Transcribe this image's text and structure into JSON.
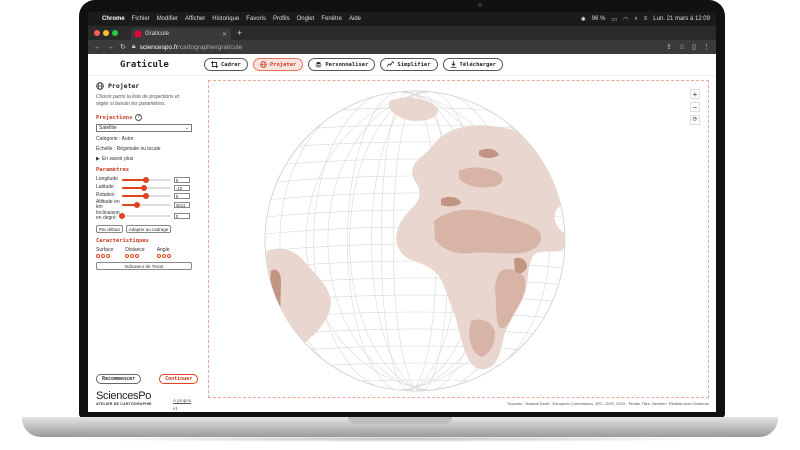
{
  "menubar": {
    "items": [
      "Chrome",
      "Fichier",
      "Modifier",
      "Afficher",
      "Historique",
      "Favoris",
      "Profils",
      "Onglet",
      "Fenêtre",
      "Aide"
    ],
    "battery": "96 %",
    "datetime": "Lun. 21 mars à 12:09"
  },
  "browser": {
    "tab_title": "Graticule",
    "url_host": "sciencespo.fr",
    "url_path": "/cartographie/graticule"
  },
  "app": {
    "logo": "Graticule",
    "steps": [
      {
        "label": "Cadrer",
        "icon": "crop-icon",
        "active": false
      },
      {
        "label": "Projeter",
        "icon": "globe-icon",
        "active": true
      },
      {
        "label": "Personnaliser",
        "icon": "layers-icon",
        "active": false
      },
      {
        "label": "Simplifier",
        "icon": "line-chart-icon",
        "active": false
      },
      {
        "label": "Télécharger",
        "icon": "download-icon",
        "active": false
      }
    ]
  },
  "sidebar": {
    "title": "Projeter",
    "description": "Choisir parmi la liste de projections et régler si besoin les paramètres.",
    "projections_heading": "Projections",
    "projection_selected": "Satellite",
    "category": "Catégorie : Autre",
    "scale": "Échelle : Régionale ou locale",
    "more": "En savoir plus",
    "params_heading": "Paramètres",
    "params": [
      {
        "label": "Longitude",
        "value": "0",
        "fraction": 0.5
      },
      {
        "label": "Latitude",
        "value": "-10",
        "fraction": 0.46
      },
      {
        "label": "Rotation",
        "value": "0",
        "fraction": 0.5
      },
      {
        "label": "Altitude en km",
        "value": "3611",
        "fraction": 0.32
      },
      {
        "label": "Inclinaison en degré",
        "value": "0",
        "fraction": 0.0
      }
    ],
    "default_button": "Par défaut",
    "adapt_button": "Adapter au cadrage",
    "chars_heading": "Caractéristiques",
    "chars": [
      "Surface",
      "Distance",
      "Angle"
    ],
    "tissot_button": "Indicateur de Tissot",
    "restart_button": "Recommencer",
    "continue_button": "Continuer",
    "brand_name": "SciencesPo",
    "brand_sub": "ATELIER DE CARTOGRAPHIE",
    "about": "À propos",
    "version": "v1"
  },
  "map": {
    "zoom_in": "+",
    "zoom_out": "−",
    "reset": "⟳",
    "sources": "Sources : Natural Earth ; European Commission, JRC, GHS, 2019 ; Terrain Tiles, Nextzen. Réalisé avec Graticule.",
    "land_color": "#e9d6cf",
    "relief_color": "#d7b4a6",
    "peak_color": "#c29483"
  }
}
